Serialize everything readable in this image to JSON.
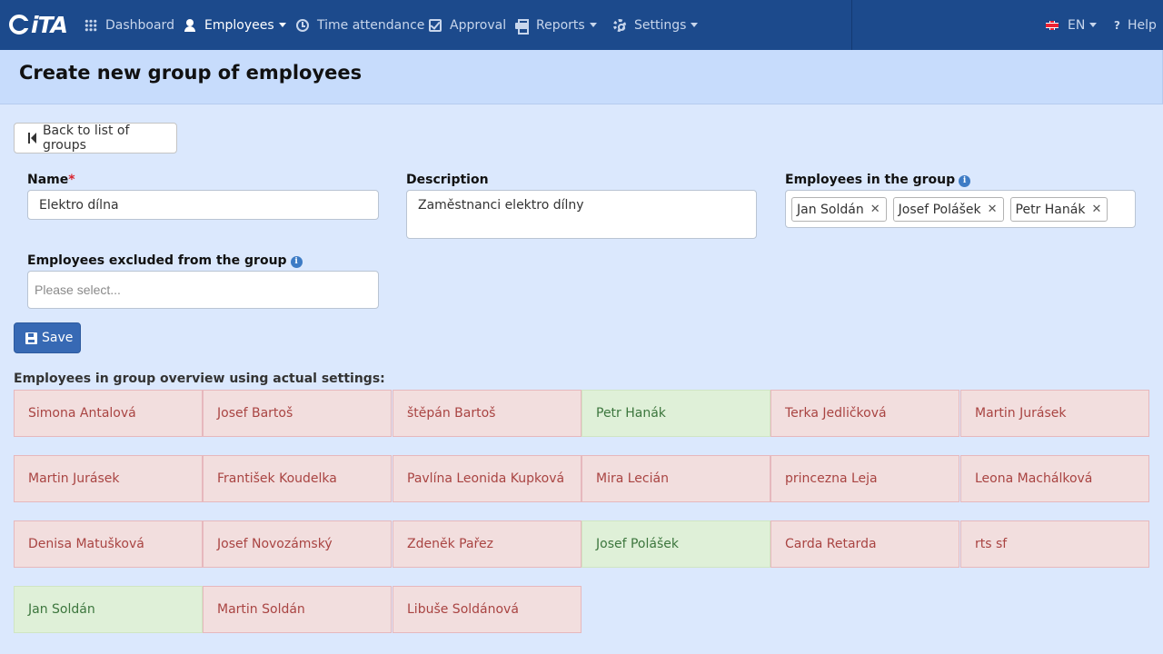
{
  "app": {
    "logo_text": "iTA"
  },
  "nav": {
    "items": [
      {
        "label": "Dashboard",
        "icon": "grid-icon"
      },
      {
        "label": "Employees",
        "icon": "user-icon",
        "active": true,
        "dropdown": true
      },
      {
        "label": "Time attendance",
        "icon": "clock-icon"
      },
      {
        "label": "Approval",
        "icon": "check-square-icon"
      },
      {
        "label": "Reports",
        "icon": "print-icon",
        "dropdown": true
      },
      {
        "label": "Settings",
        "icon": "gear-icon",
        "dropdown": true
      }
    ],
    "language": "EN",
    "help": "Help"
  },
  "page": {
    "title": "Create new group of employees",
    "back_label": "Back to list of groups"
  },
  "form": {
    "name_label": "Name",
    "name_required": "*",
    "name_value": "Elektro dílna",
    "description_label": "Description",
    "description_value": "Zaměstnanci elektro dílny",
    "included_label": "Employees in the group",
    "included_tags": [
      "Jan Soldán",
      "Josef Polášek",
      "Petr Hanák"
    ],
    "excluded_label": "Employees excluded from the group",
    "excluded_placeholder": "Please select...",
    "save_label": "Save"
  },
  "overview": {
    "title": "Employees in group overview using actual settings:",
    "employees": [
      {
        "name": "Simona Antalová",
        "in_group": false
      },
      {
        "name": "Josef Bartoš",
        "in_group": false
      },
      {
        "name": "štěpán Bartoš",
        "in_group": false
      },
      {
        "name": "Petr Hanák",
        "in_group": true
      },
      {
        "name": "Terka Jedličková",
        "in_group": false
      },
      {
        "name": "Martin Jurásek",
        "in_group": false
      },
      {
        "name": "Martin Jurásek",
        "in_group": false
      },
      {
        "name": "František Koudelka",
        "in_group": false
      },
      {
        "name": "Pavlína Leonida Kupková",
        "in_group": false
      },
      {
        "name": "Mira Lecián",
        "in_group": false
      },
      {
        "name": "princezna Leja",
        "in_group": false
      },
      {
        "name": "Leona Machálková",
        "in_group": false
      },
      {
        "name": "Denisa Matušková",
        "in_group": false
      },
      {
        "name": "Josef Novozámský",
        "in_group": false
      },
      {
        "name": "Zdeněk Pařez",
        "in_group": false
      },
      {
        "name": "Josef Polášek",
        "in_group": true
      },
      {
        "name": "Carda Retarda",
        "in_group": false
      },
      {
        "name": "rts sf",
        "in_group": false
      },
      {
        "name": "Jan Soldán",
        "in_group": true
      },
      {
        "name": "Martin Soldán",
        "in_group": false
      },
      {
        "name": "Libuše Soldánová",
        "in_group": false
      }
    ]
  },
  "colors": {
    "navbar": "#1c4a8c",
    "page_bg": "#dbe8fd",
    "header_bg": "#c7dcfc",
    "primary": "#3769b4",
    "in_group_bg": "#dff0d8",
    "not_in_group_bg": "#f2dede"
  }
}
